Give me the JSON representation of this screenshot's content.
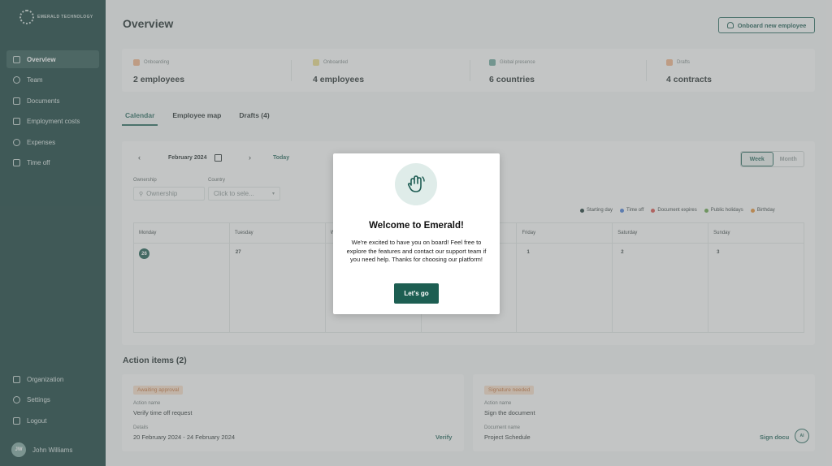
{
  "brand": {
    "logo_text": "EMERALD TECHNOLOGY"
  },
  "sidebar": {
    "items": [
      {
        "label": "Overview",
        "icon": "chart-icon"
      },
      {
        "label": "Team",
        "icon": "people-icon"
      },
      {
        "label": "Documents",
        "icon": "document-icon"
      },
      {
        "label": "Employment costs",
        "icon": "calculator-icon"
      },
      {
        "label": "Expenses",
        "icon": "coins-icon"
      },
      {
        "label": "Time off",
        "icon": "calendar-icon"
      }
    ],
    "bottom_items": [
      {
        "label": "Organization",
        "icon": "building-icon"
      },
      {
        "label": "Settings",
        "icon": "gear-icon"
      },
      {
        "label": "Logout",
        "icon": "logout-icon"
      }
    ],
    "user": {
      "initials": "JW",
      "name": "John Williams"
    }
  },
  "header": {
    "title": "Overview",
    "onboard_label": "Onboard new employee"
  },
  "stats": [
    {
      "label": "Onboarding",
      "value": "2 employees",
      "color": "#f2b48a"
    },
    {
      "label": "Onboarded",
      "value": "4 employees",
      "color": "#e8d98a"
    },
    {
      "label": "Global presence",
      "value": "6 countries",
      "color": "#6fa89e"
    },
    {
      "label": "Drafts",
      "value": "4 contracts",
      "color": "#f2b48a"
    }
  ],
  "tabs": [
    {
      "label": "Calendar"
    },
    {
      "label": "Employee map"
    },
    {
      "label": "Drafts (4)"
    }
  ],
  "calendar": {
    "month_label": "February 2024",
    "today_label": "Today",
    "ownership_label": "Ownership",
    "ownership_placeholder": "Ownership",
    "country_label": "Country",
    "country_placeholder": "Click to sele...",
    "view_week": "Week",
    "view_month": "Month",
    "legend": [
      {
        "label": "Starting day",
        "color": "#1f3b38"
      },
      {
        "label": "Time off",
        "color": "#4a7fd6"
      },
      {
        "label": "Document expires",
        "color": "#d9534f"
      },
      {
        "label": "Public holidays",
        "color": "#6aa84f"
      },
      {
        "label": "Birthday",
        "color": "#e69138"
      }
    ],
    "days": [
      {
        "name": "Monday",
        "date": "26"
      },
      {
        "name": "Tuesday",
        "date": "27"
      },
      {
        "name": "W",
        "date": ""
      },
      {
        "name": "",
        "date": ""
      },
      {
        "name": "Friday",
        "date": "1"
      },
      {
        "name": "Saturday",
        "date": "2"
      },
      {
        "name": "Sunday",
        "date": "3"
      }
    ]
  },
  "actions": {
    "title": "Action items (2)",
    "cards": [
      {
        "badge": "Awaiting approval",
        "name_label": "Action name",
        "name_value": "Verify time off request",
        "detail_label": "Details",
        "detail_value": "20 February 2024 - 24 February 2024",
        "link": "Verify"
      },
      {
        "badge": "Signature needed",
        "name_label": "Action name",
        "name_value": "Sign the document",
        "detail_label": "Document name",
        "detail_value": "Project Schedule",
        "link": "Sign docu"
      }
    ],
    "chat_label": "AI"
  },
  "modal": {
    "title": "Welcome to Emerald!",
    "text": "We're excited to have you on board! Feel free to explore the features and contact our support team if you need help. Thanks for choosing our platform!",
    "button": "Let's go"
  }
}
